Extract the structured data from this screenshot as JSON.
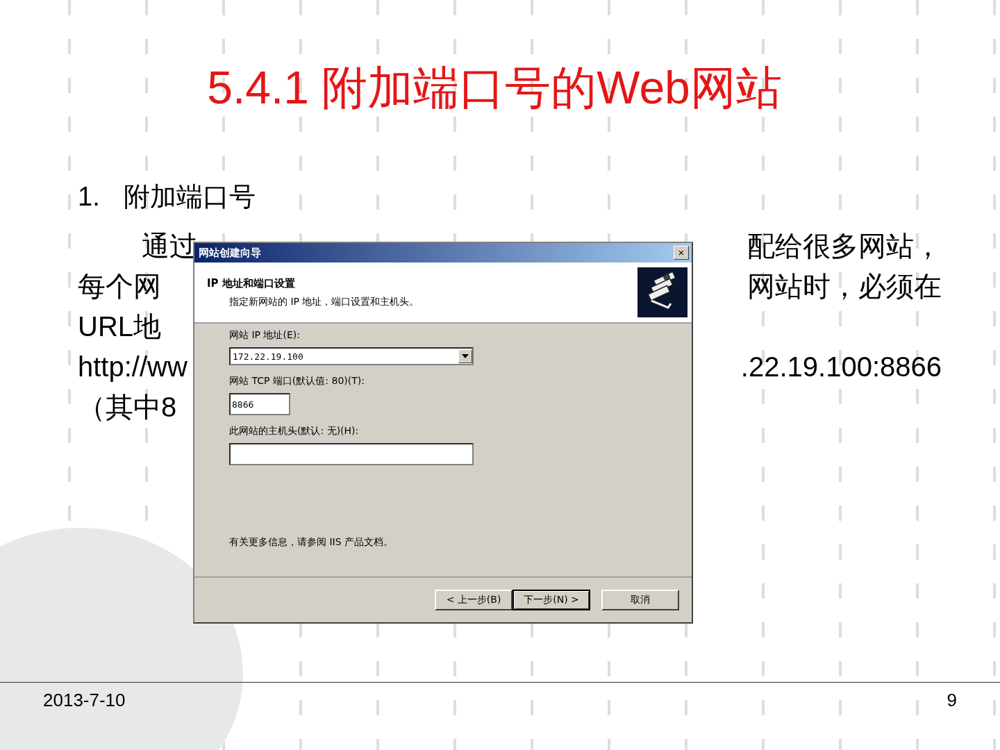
{
  "slide": {
    "title": "5.4.1 附加端口号的Web网站",
    "heading_number": "1.",
    "heading": "附加端口号",
    "paragraph_lines": [
      {
        "left": "通过",
        "right": "配给很多网站，",
        "indent": true
      },
      {
        "left": "每个网",
        "right": "网站时，必须在",
        "indent": false
      },
      {
        "left": "URL地",
        "indent": false
      },
      {
        "left": "http://ww",
        "right": ".22.19.100:8866",
        "indent": false
      },
      {
        "left": "（其中8",
        "indent": false
      }
    ],
    "footer": {
      "date": "2013-7-10",
      "page": "9"
    }
  },
  "dialog": {
    "title": "网站创建向导",
    "close": "×",
    "header_title": "IP 地址和端口设置",
    "header_subtitle": "指定新网站的 IP 地址，端口设置和主机头。",
    "fields": [
      {
        "kind": "combo",
        "label": "网站 IP 地址(E):",
        "value": "172.22.19.100"
      },
      {
        "kind": "short",
        "label": "网站 TCP 端口(默认值: 80)(T):",
        "value": "8866"
      },
      {
        "kind": "wide",
        "label": "此网站的主机头(默认: 无)(H):"
      }
    ],
    "info": "有关更多信息，请参阅 IIS 产品文档。",
    "buttons": [
      {
        "label": "< 上一步(B)",
        "selected": false
      },
      {
        "label": "下一步(N) >",
        "selected": true
      },
      {
        "label": "取消",
        "selected": false
      }
    ]
  }
}
